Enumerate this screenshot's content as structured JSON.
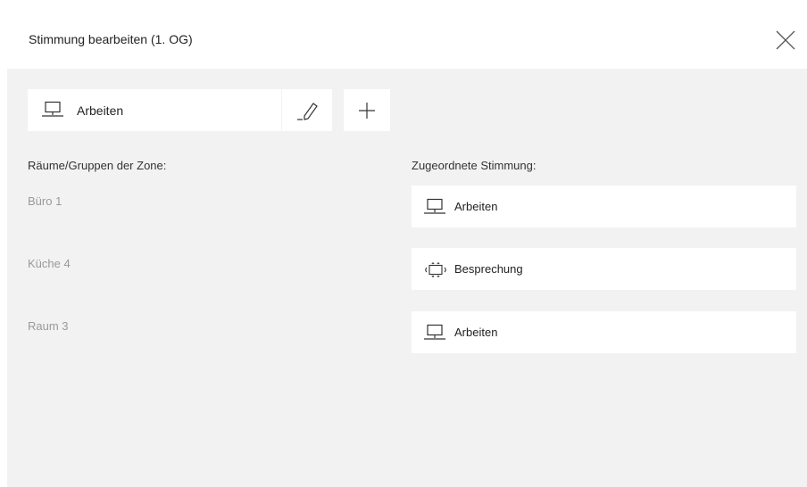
{
  "dialog": {
    "title": "Stimmung bearbeiten (1. OG)"
  },
  "toolbar": {
    "selected_mood": {
      "label": "Arbeiten",
      "icon": "monitor-icon"
    },
    "edit_icon": "pencil-icon",
    "add_icon": "plus-icon"
  },
  "columns": {
    "rooms_header": "Räume/Gruppen der Zone:",
    "assigned_header": "Zugeordnete Stimmung:"
  },
  "rows": [
    {
      "room": "Büro 1",
      "mood": "Arbeiten",
      "icon": "monitor-icon"
    },
    {
      "room": "Küche 4",
      "mood": "Besprechung",
      "icon": "meeting-table-icon"
    },
    {
      "room": "Raum 3",
      "mood": "Arbeiten",
      "icon": "monitor-icon"
    }
  ]
}
